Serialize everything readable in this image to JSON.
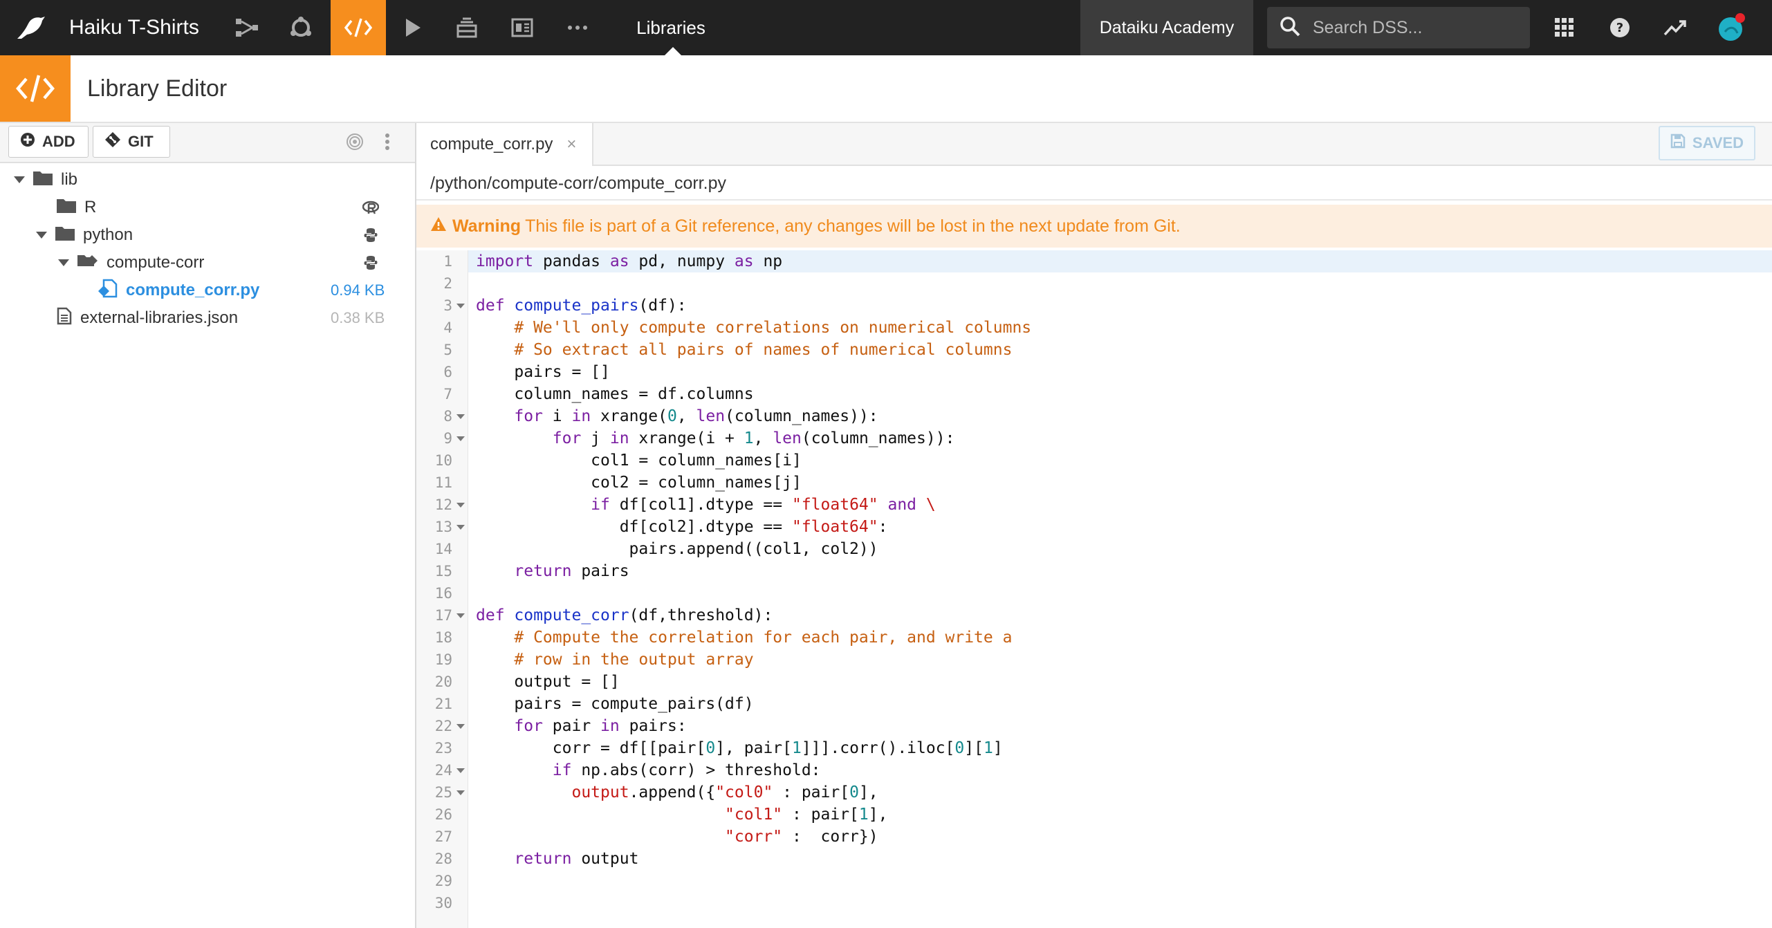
{
  "topbar": {
    "project_name": "Haiku T-Shirts",
    "section": "Libraries",
    "academy": "Dataiku Academy",
    "search_placeholder": "Search DSS...",
    "active_color": "#f68e1e",
    "bar_color": "#222222"
  },
  "header": {
    "title": "Library Editor"
  },
  "left_toolbar": {
    "add_label": "ADD",
    "git_label": "GIT"
  },
  "tree": {
    "root": "lib",
    "r_folder": "R",
    "python_folder": "python",
    "compute_folder": "compute-corr",
    "selected_file": "compute_corr.py",
    "selected_file_size": "0.94 KB",
    "json_file": "external-libraries.json",
    "json_file_size": "0.38 KB",
    "selected_color": "#2c8fe0"
  },
  "editor": {
    "tab_label": "compute_corr.py",
    "tab_close": "×",
    "saved_label": "SAVED",
    "path": "/python/compute-corr/compute_corr.py",
    "warning_label": "Warning",
    "warning_text": "This file is part of a Git reference, any changes will be lost in the next update from Git."
  },
  "code": {
    "line_numbers": [
      "1",
      "2",
      "3",
      "4",
      "5",
      "6",
      "7",
      "8",
      "9",
      "10",
      "11",
      "12",
      "13",
      "14",
      "15",
      "16",
      "17",
      "18",
      "19",
      "20",
      "21",
      "22",
      "23",
      "24",
      "25",
      "26",
      "27",
      "28",
      "29",
      "30"
    ],
    "fold_lines": [
      3,
      8,
      9,
      12,
      13,
      17,
      22,
      24,
      25
    ]
  }
}
